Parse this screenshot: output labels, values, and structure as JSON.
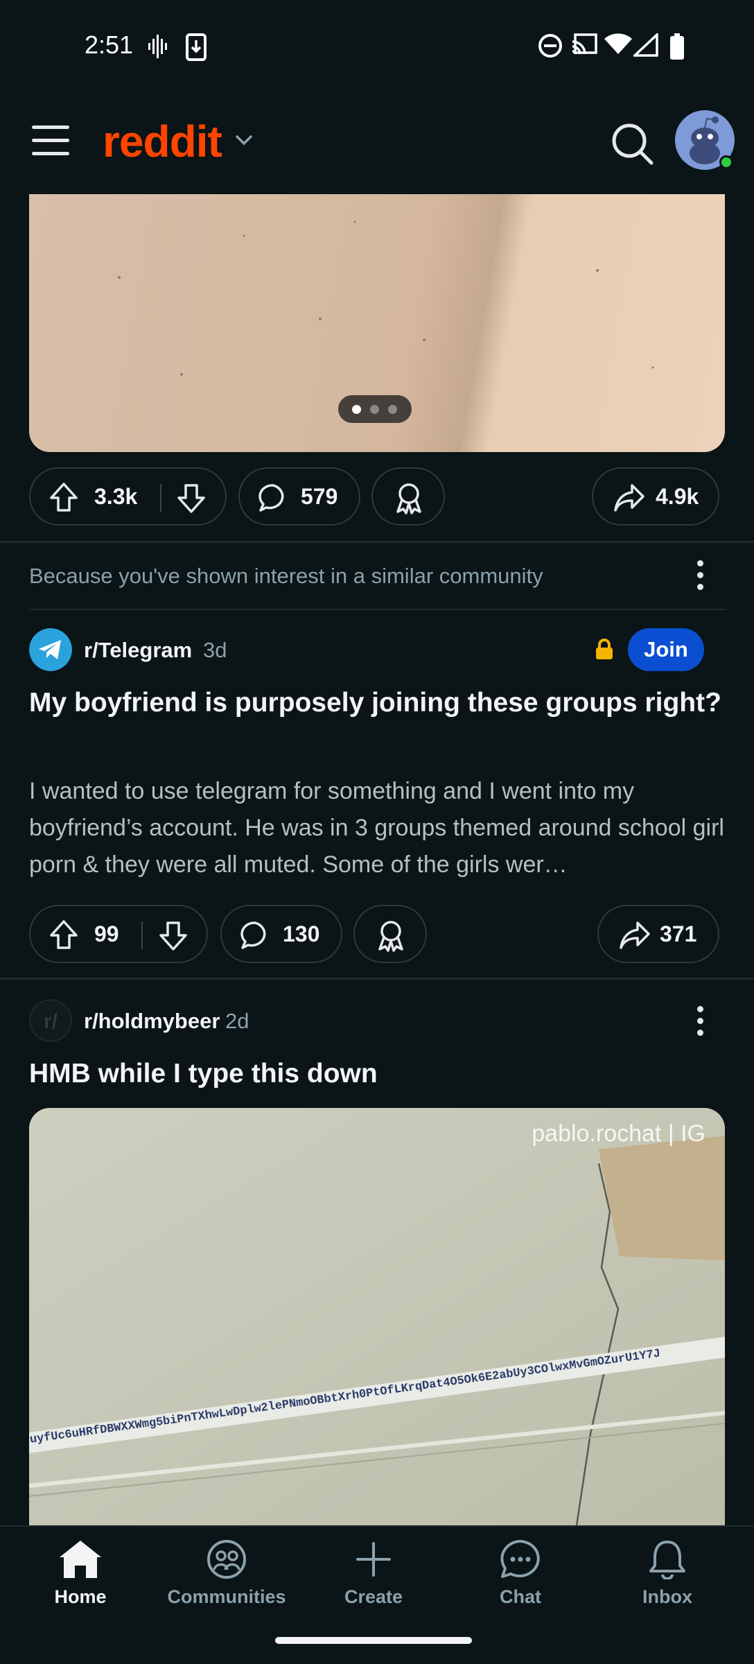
{
  "status_bar": {
    "time": "2:51",
    "icons": [
      "audio-wave-icon",
      "download-icon",
      "do-not-disturb-icon",
      "cast-icon",
      "wifi-icon",
      "cell-signal-icon",
      "battery-icon"
    ]
  },
  "app_bar": {
    "logo_text": "reddit",
    "brand_color": "#ff4500",
    "icons": [
      "menu-icon",
      "chevron-down-icon",
      "search-icon",
      "avatar"
    ]
  },
  "post1": {
    "carousel_dots": 3,
    "carousel_active_index": 0,
    "upvotes": "3.3k",
    "comments": "579",
    "shares": "4.9k"
  },
  "post2": {
    "reason": "Because you've shown interest in a similar community",
    "subreddit": "r/Telegram",
    "age": "3d",
    "join_label": "Join",
    "title": "My boyfriend is purposely joining these groups right?",
    "body": "I wanted to use telegram for something and I went into my boyfriend’s account. He was in 3 groups themed around school girl porn & they were all muted. Some of the girls wer…",
    "upvotes": "99",
    "comments": "130",
    "shares": "371"
  },
  "post3": {
    "subreddit": "r/holdmybeer",
    "age": "2d",
    "title": "HMB while I type this down",
    "watermark": "pablo.rochat | IG",
    "tape_text": "uyfUc6uHRfDBWXXWmg5biPnTXhwLwDplw2lePNmoOBbtXrh0PtOfLKrqDat4O5Ok6E2abUy3COlwxMvGmOZurU1Y7J"
  },
  "bottom_nav": {
    "items": [
      {
        "label": "Home",
        "active": true
      },
      {
        "label": "Communities",
        "active": false
      },
      {
        "label": "Create",
        "active": false
      },
      {
        "label": "Chat",
        "active": false
      },
      {
        "label": "Inbox",
        "active": false
      }
    ]
  }
}
